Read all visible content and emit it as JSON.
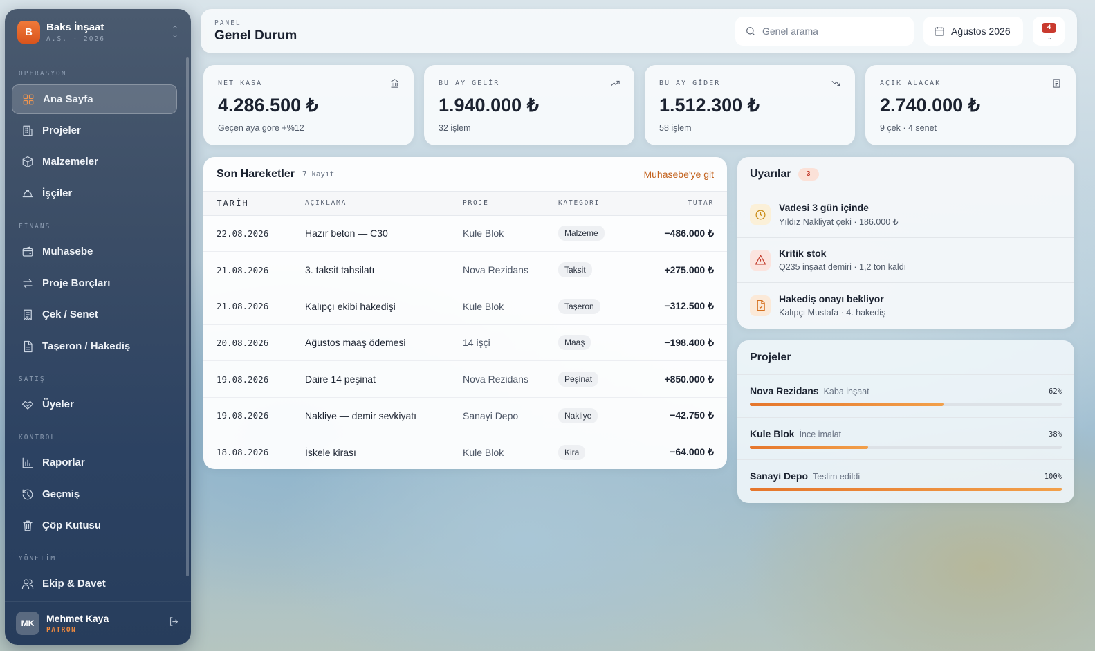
{
  "company": {
    "initial": "B",
    "name": "Baks İnşaat",
    "meta": "A.Ş. · 2026"
  },
  "sidebar": {
    "sections": [
      "OPERASYON",
      "FİNANS",
      "SATIŞ",
      "KONTROL",
      "YÖNETİM"
    ],
    "items": [
      {
        "label": "Ana Sayfa",
        "icon": "dashboard-icon",
        "active": true
      },
      {
        "label": "Projeler",
        "icon": "building-icon"
      },
      {
        "label": "Malzemeler",
        "icon": "box-icon"
      },
      {
        "label": "İşçiler",
        "icon": "helmet-icon"
      },
      {
        "label": "Muhasebe",
        "icon": "wallet-icon"
      },
      {
        "label": "Proje Borçları",
        "icon": "transfer-icon"
      },
      {
        "label": "Çek / Senet",
        "icon": "receipt-icon"
      },
      {
        "label": "Taşeron / Hakediş",
        "icon": "document-icon"
      },
      {
        "label": "Üyeler",
        "icon": "handshake-icon"
      },
      {
        "label": "Raporlar",
        "icon": "chart-icon"
      },
      {
        "label": "Geçmiş",
        "icon": "history-icon"
      },
      {
        "label": "Çöp Kutusu",
        "icon": "trash-icon"
      },
      {
        "label": "Ekip & Davet",
        "icon": "users-icon"
      }
    ],
    "user": {
      "initials": "MK",
      "name": "Mehmet Kaya",
      "role": "PATRON"
    }
  },
  "header": {
    "kicker": "PANEL",
    "title": "Genel Durum",
    "search_placeholder": "Genel arama",
    "date": "Ağustos 2026",
    "notif_count": "4"
  },
  "stats": [
    {
      "label": "NET KASA",
      "value": "4.286.500 ₺",
      "sub": "Geçen aya göre +%12",
      "icon": "bank-icon"
    },
    {
      "label": "BU AY GELİR",
      "value": "1.940.000 ₺",
      "sub": "32 işlem",
      "icon": "trending-up-icon"
    },
    {
      "label": "BU AY GİDER",
      "value": "1.512.300 ₺",
      "sub": "58 işlem",
      "icon": "trending-down-icon"
    },
    {
      "label": "AÇIK ALACAK",
      "value": "2.740.000 ₺",
      "sub": "9 çek · 4 senet",
      "icon": "receipt-icon"
    }
  ],
  "transactions": {
    "title": "Son Hareketler",
    "count": "7 kayıt",
    "link": "Muhasebe'ye git",
    "columns": [
      "TARİH",
      "AÇIKLAMA",
      "PROJE",
      "KATEGORİ",
      "TUTAR"
    ],
    "rows": [
      {
        "date": "22.08.2026",
        "desc": "Hazır beton — C30",
        "project": "Kule Blok",
        "category": "Malzeme",
        "amount": "−486.000 ₺",
        "sign": "neg"
      },
      {
        "date": "21.08.2026",
        "desc": "3. taksit tahsilatı",
        "project": "Nova Rezidans",
        "category": "Taksit",
        "amount": "+275.000 ₺",
        "sign": "pos"
      },
      {
        "date": "21.08.2026",
        "desc": "Kalıpçı ekibi hakedişi",
        "project": "Kule Blok",
        "category": "Taşeron",
        "amount": "−312.500 ₺",
        "sign": "neg"
      },
      {
        "date": "20.08.2026",
        "desc": "Ağustos maaş ödemesi",
        "project": "14 işçi",
        "category": "Maaş",
        "amount": "−198.400 ₺",
        "sign": "neg"
      },
      {
        "date": "19.08.2026",
        "desc": "Daire 14 peşinat",
        "project": "Nova Rezidans",
        "category": "Peşinat",
        "amount": "+850.000 ₺",
        "sign": "pos"
      },
      {
        "date": "19.08.2026",
        "desc": "Nakliye — demir sevkiyatı",
        "project": "Sanayi Depo",
        "category": "Nakliye",
        "amount": "−42.750 ₺",
        "sign": "neg"
      },
      {
        "date": "18.08.2026",
        "desc": "İskele kirası",
        "project": "Kule Blok",
        "category": "Kira",
        "amount": "−64.000 ₺",
        "sign": "neg"
      }
    ]
  },
  "alerts": {
    "title": "Uyarılar",
    "count": "3",
    "items": [
      {
        "title": "Vadesi 3 gün içinde",
        "detail": "Yıldız Nakliyat çeki · 186.000 ₺",
        "icon": "clock-icon",
        "color": "#c98a12",
        "bg": "#fbf0d8"
      },
      {
        "title": "Kritik stok",
        "detail": "Q235 inşaat demiri · 1,2 ton kaldı",
        "icon": "warning-icon",
        "color": "#c23a2b",
        "bg": "#fbe4df"
      },
      {
        "title": "Hakediş onayı bekliyor",
        "detail": "Kalıpçı Mustafa · 4. hakediş",
        "icon": "document-icon",
        "color": "#d5701f",
        "bg": "#fbe9d8"
      }
    ]
  },
  "projects": {
    "title": "Projeler",
    "items": [
      {
        "name": "Nova Rezidans",
        "stage": "Kaba inşaat",
        "percent": "62%",
        "progress": 62
      },
      {
        "name": "Kule Blok",
        "stage": "İnce imalat",
        "percent": "38%",
        "progress": 38
      },
      {
        "name": "Sanayi Depo",
        "stage": "Teslim edildi",
        "percent": "100%",
        "progress": 100
      }
    ]
  }
}
